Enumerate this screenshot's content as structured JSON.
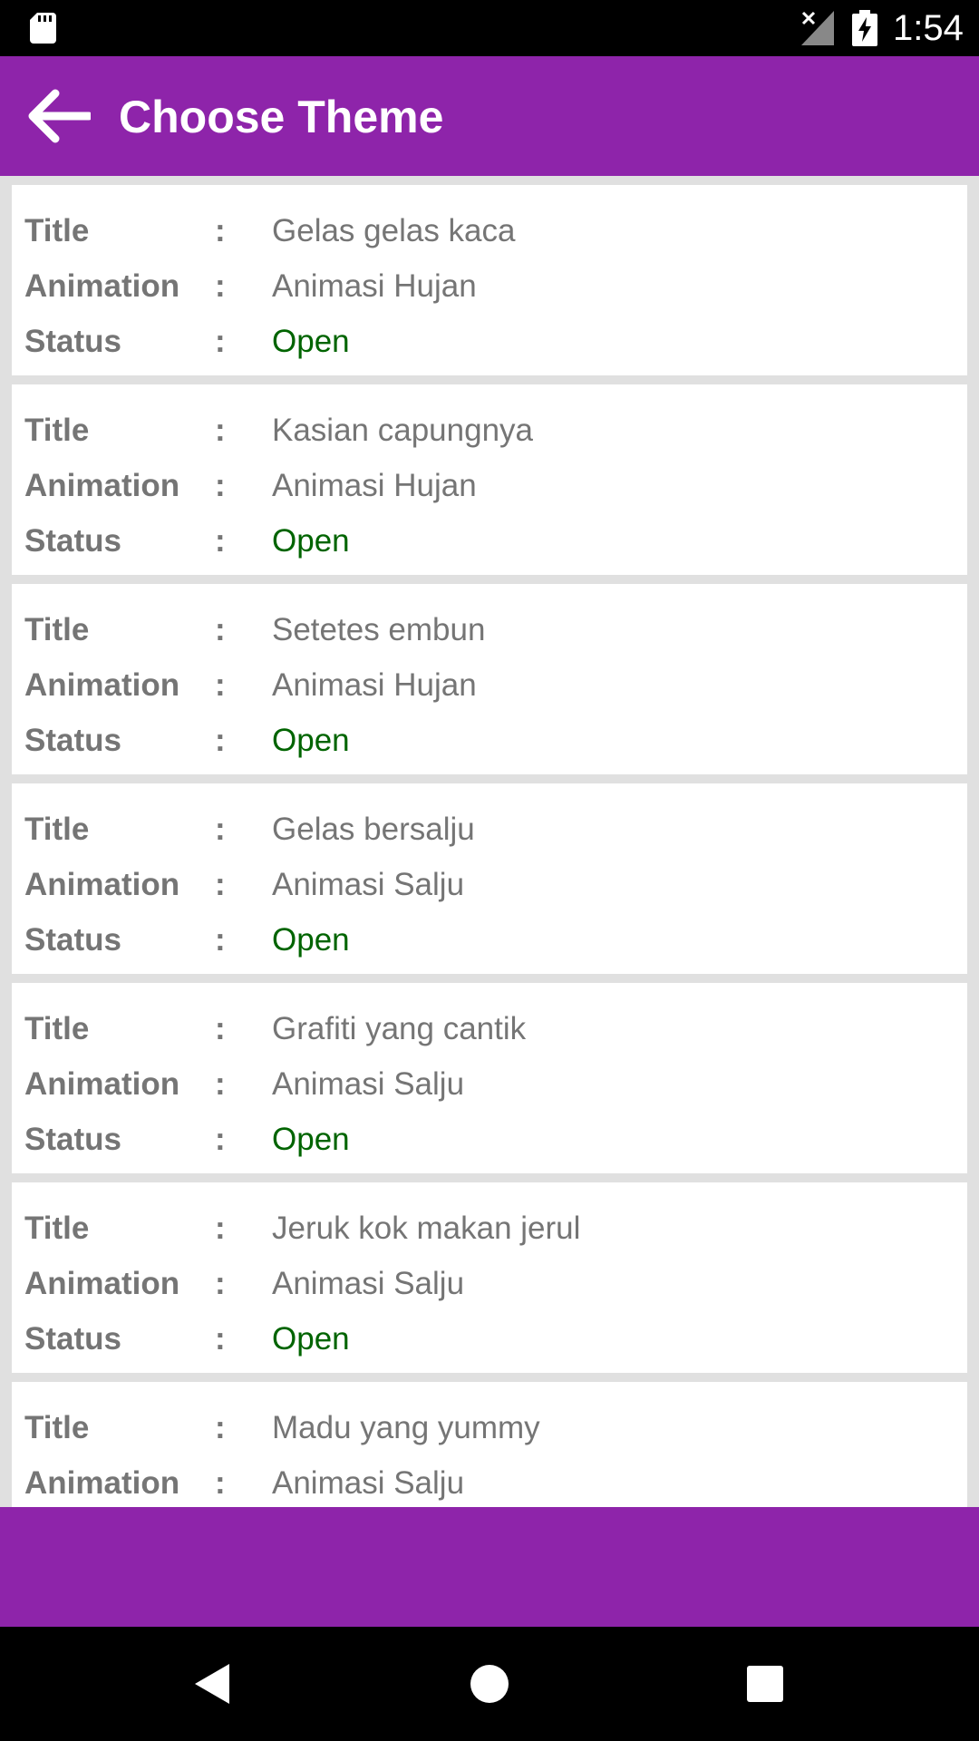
{
  "status_bar": {
    "time": "1:54"
  },
  "app_bar": {
    "title": "Choose Theme"
  },
  "labels": {
    "title": "Title",
    "animation": "Animation",
    "status": "Status",
    "separator": ":"
  },
  "themes": [
    {
      "title": "Gelas gelas kaca",
      "animation": "Animasi Hujan",
      "status": "Open"
    },
    {
      "title": "Kasian capungnya",
      "animation": "Animasi Hujan",
      "status": "Open"
    },
    {
      "title": "Setetes embun",
      "animation": "Animasi Hujan",
      "status": "Open"
    },
    {
      "title": "Gelas bersalju",
      "animation": "Animasi Salju",
      "status": "Open"
    },
    {
      "title": "Grafiti yang cantik",
      "animation": "Animasi Salju",
      "status": "Open"
    },
    {
      "title": "Jeruk kok makan jerul",
      "animation": "Animasi Salju",
      "status": "Open"
    },
    {
      "title": "Madu yang yummy",
      "animation": "Animasi Salju",
      "status": ""
    }
  ],
  "colors": {
    "accent": "#8e24aa",
    "status_open": "#006400",
    "text": "#757575"
  }
}
